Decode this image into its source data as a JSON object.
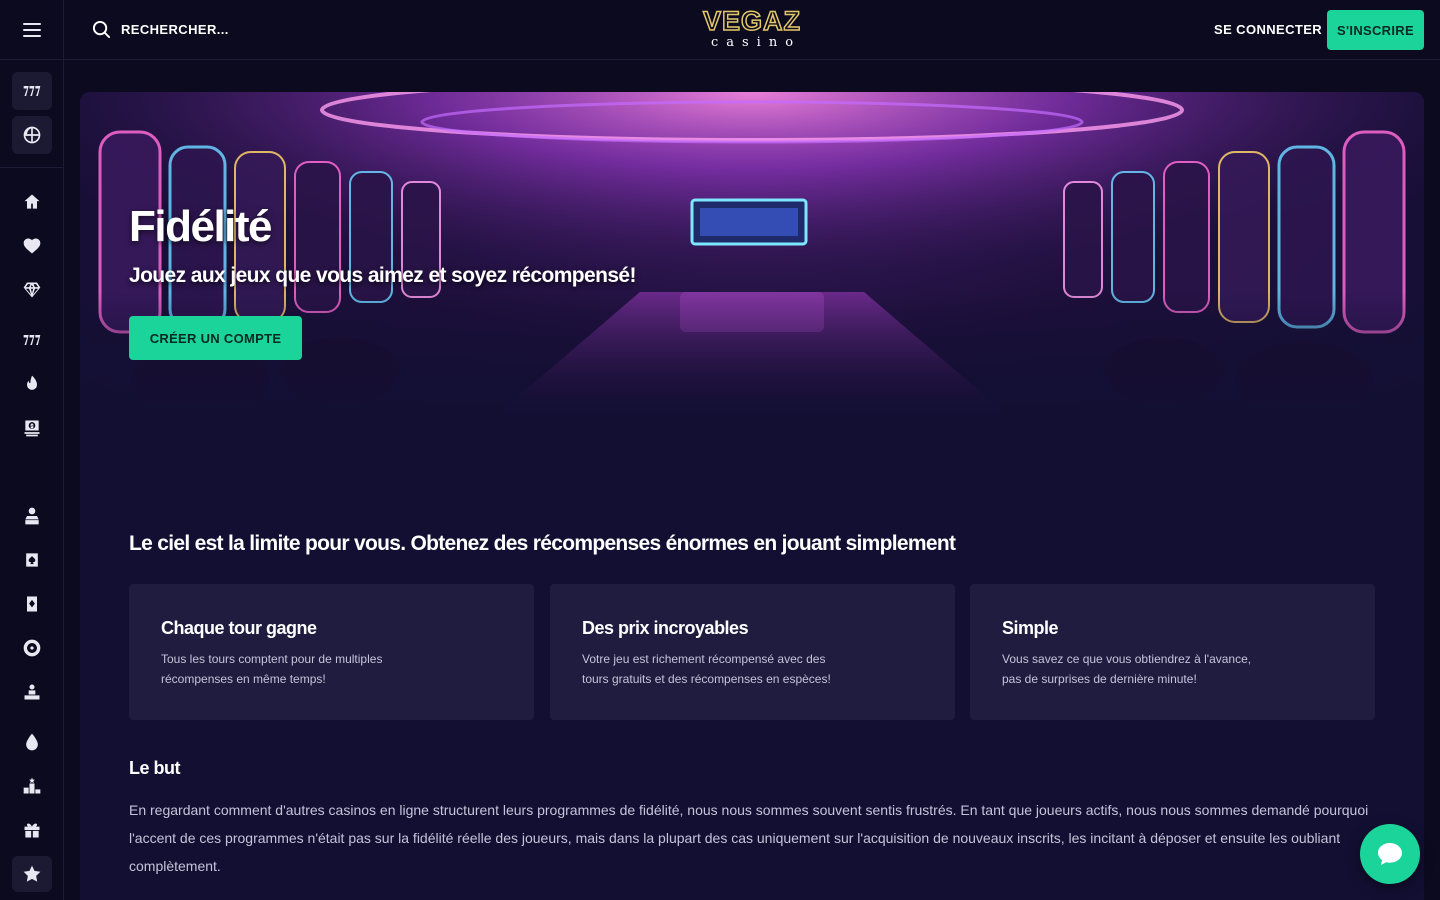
{
  "header": {
    "menu_icon": "hamburger-icon",
    "search_placeholder": "RECHERCHER...",
    "logo_top": "VEGAZ",
    "logo_bottom": "casino",
    "login_label": "SE CONNECTER",
    "signup_label": "S'INSCRIRE"
  },
  "sidebar": {
    "top_items": [
      {
        "icon": "slot-777-icon"
      },
      {
        "icon": "basketball-icon"
      }
    ],
    "items": [
      {
        "icon": "home-icon"
      },
      {
        "icon": "heart-icon"
      },
      {
        "icon": "diamond-icon"
      },
      {
        "icon": "slot-777-icon"
      },
      {
        "icon": "fire-icon"
      },
      {
        "icon": "money-bag-icon"
      },
      {
        "icon": "live-dealer-icon"
      },
      {
        "icon": "card-suit-icon"
      },
      {
        "icon": "poker-card-icon"
      },
      {
        "icon": "roulette-icon"
      },
      {
        "icon": "person-podium-icon"
      },
      {
        "icon": "drop-icon"
      },
      {
        "icon": "ranking-icon"
      },
      {
        "icon": "gift-icon"
      },
      {
        "icon": "star-icon"
      }
    ],
    "active_item": "star-icon"
  },
  "hero": {
    "title": "Fidélité",
    "subtitle": "Jouez aux jeux que vous aimez et soyez récompensé!",
    "cta_label": "CRÉER UN COMPTE"
  },
  "content": {
    "headline": "Le ciel est la limite pour vous. Obtenez des récompenses énormes en jouant simplement",
    "cards": [
      {
        "title": "Chaque tour gagne",
        "text": "Tous les tours comptent pour de multiples récompenses en même temps!"
      },
      {
        "title": "Des prix incroyables",
        "text": "Votre jeu est richement récompensé avec des tours gratuits et des récompenses en espèces!"
      },
      {
        "title": "Simple",
        "text": "Vous savez ce que vous obtiendrez à l'avance, pas de surprises de dernière minute!"
      }
    ],
    "goal_title": "Le but",
    "goal_text": "En regardant comment d'autres casinos en ligne structurent leurs programmes de fidélité, nous nous sommes souvent sentis frustrés. En tant que joueurs actifs, nous nous sommes demandé pourquoi l'accent de ces programmes n'était pas sur la fidélité réelle des joueurs, mais dans la plupart des cas uniquement sur l'acquisition de nouveaux inscrits, les incitant à déposer et ensuite les oubliant complètement."
  },
  "chat": {
    "icon": "chat-bubble-icon"
  },
  "colors": {
    "accent": "#1bd49a",
    "background": "#0b0a1f",
    "panel": "#130f33",
    "card": "#201c40",
    "logo_gold": "#e3c76a"
  }
}
